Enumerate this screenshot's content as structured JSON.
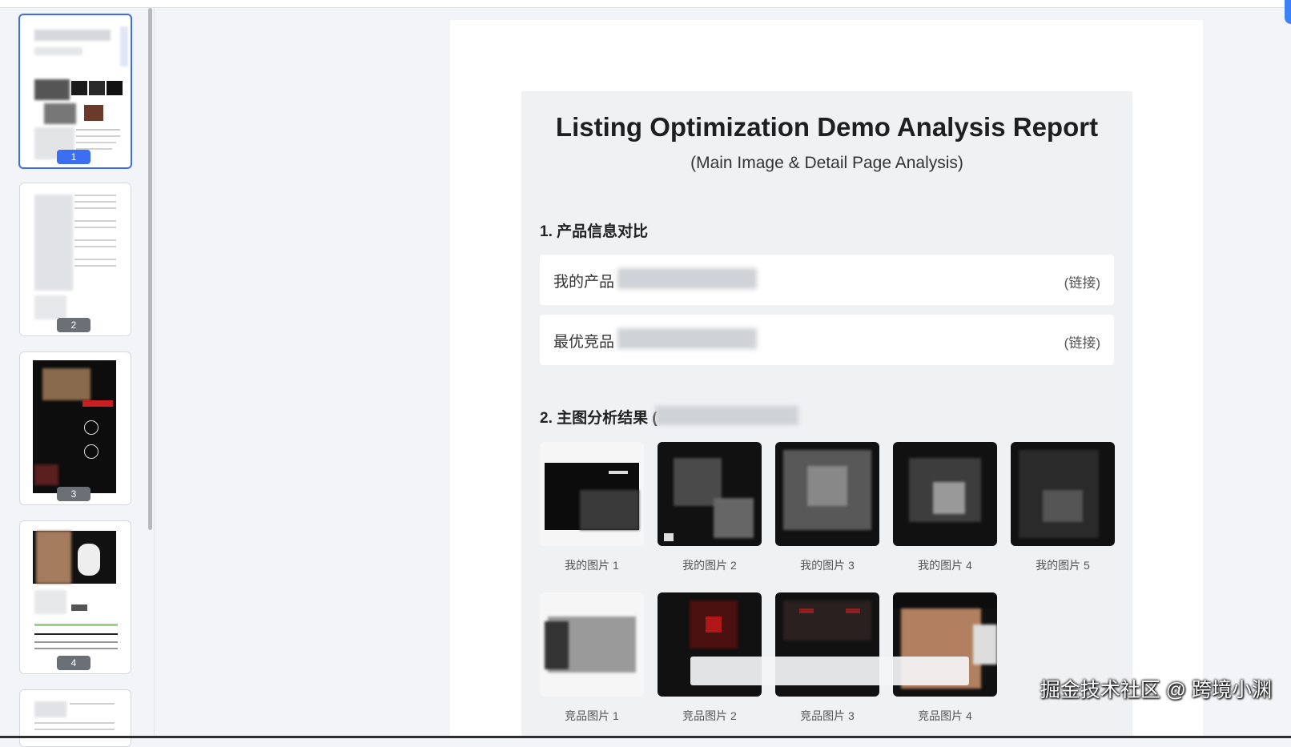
{
  "report": {
    "title": "Listing Optimization Demo Analysis Report",
    "subtitle": "(Main Image & Detail Page Analysis)"
  },
  "section1": {
    "heading": "1. 产品信息对比",
    "rows": [
      {
        "label": "我的产品",
        "link": "(链接)"
      },
      {
        "label": "最优竞品",
        "link": "(链接)"
      }
    ]
  },
  "section2": {
    "heading": "2. 主图分析结果 (",
    "my_images": [
      "我的图片 1",
      "我的图片 2",
      "我的图片 3",
      "我的图片 4",
      "我的图片 5"
    ],
    "competitor_images": [
      "竞品图片 1",
      "竞品图片 2",
      "竞品图片 3",
      "竞品图片 4"
    ]
  },
  "thumbnails": {
    "pages": [
      "1",
      "2",
      "3",
      "4"
    ],
    "active_page": "1"
  },
  "watermark": "掘金技术社区 @ 跨境小渊",
  "colors": {
    "accent": "#3b6ef0",
    "page_background": "#f2f4f7",
    "card_background": "#f0f1f3"
  }
}
